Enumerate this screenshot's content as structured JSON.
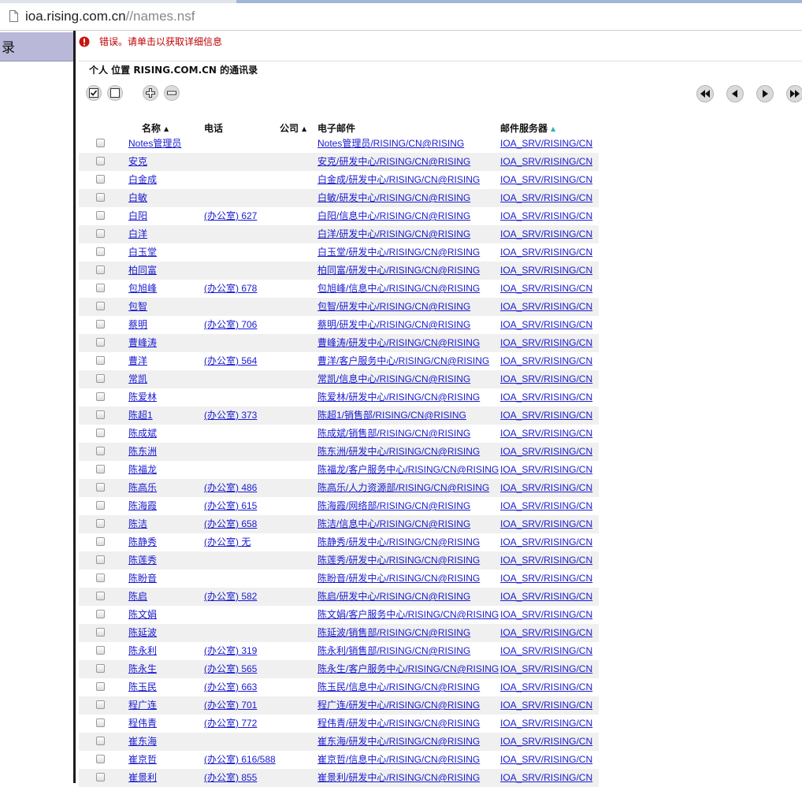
{
  "browser": {
    "url_host": "ioa.rising.com.cn",
    "url_path": "//names.nsf"
  },
  "left_frame": {
    "header": "录"
  },
  "error": {
    "message": "错误。请单击以获取详细信息"
  },
  "view": {
    "title": "个人 位置 RISING.COM.CN 的通讯录"
  },
  "columns": {
    "name": "名称",
    "phone": "电话",
    "company": "公司",
    "email": "电子邮件",
    "server": "邮件服务器"
  },
  "sort_glyph": "▲",
  "rows": [
    {
      "name": "Notes管理员",
      "phone": "",
      "email": "Notes管理员/RISING/CN@RISING",
      "server": "IOA_SRV/RISING/CN"
    },
    {
      "name": "安克",
      "phone": "",
      "email": "安克/研发中心/RISING/CN@RISING",
      "server": "IOA_SRV/RISING/CN"
    },
    {
      "name": "白金成",
      "phone": "",
      "email": "白金成/研发中心/RISING/CN@RISING",
      "server": "IOA_SRV/RISING/CN"
    },
    {
      "name": "白敏",
      "phone": "",
      "email": "白敏/研发中心/RISING/CN@RISING",
      "server": "IOA_SRV/RISING/CN"
    },
    {
      "name": "白阳",
      "phone": "(办公室) 627",
      "email": "白阳/信息中心/RISING/CN@RISING",
      "server": "IOA_SRV/RISING/CN"
    },
    {
      "name": "白洋",
      "phone": "",
      "email": "白洋/研发中心/RISING/CN@RISING",
      "server": "IOA_SRV/RISING/CN"
    },
    {
      "name": "白玉堂",
      "phone": "",
      "email": "白玉堂/研发中心/RISING/CN@RISING",
      "server": "IOA_SRV/RISING/CN"
    },
    {
      "name": "柏同富",
      "phone": "",
      "email": "柏同富/研发中心/RISING/CN@RISING",
      "server": "IOA_SRV/RISING/CN"
    },
    {
      "name": "包旭峰",
      "phone": "(办公室) 678",
      "email": "包旭峰/信息中心/RISING/CN@RISING",
      "server": "IOA_SRV/RISING/CN"
    },
    {
      "name": "包智",
      "phone": "",
      "email": "包智/研发中心/RISING/CN@RISING",
      "server": "IOA_SRV/RISING/CN"
    },
    {
      "name": "蔡明",
      "phone": "(办公室) 706",
      "email": "蔡明/研发中心/RISING/CN@RISING",
      "server": "IOA_SRV/RISING/CN"
    },
    {
      "name": "曹峰涛",
      "phone": "",
      "email": "曹峰涛/研发中心/RISING/CN@RISING",
      "server": "IOA_SRV/RISING/CN"
    },
    {
      "name": "曹洋",
      "phone": "(办公室) 564",
      "email": "曹洋/客户服务中心/RISING/CN@RISING",
      "server": "IOA_SRV/RISING/CN"
    },
    {
      "name": "常凯",
      "phone": "",
      "email": "常凯/信息中心/RISING/CN@RISING",
      "server": "IOA_SRV/RISING/CN"
    },
    {
      "name": "陈爱林",
      "phone": "",
      "email": "陈爱林/研发中心/RISING/CN@RISING",
      "server": "IOA_SRV/RISING/CN"
    },
    {
      "name": "陈超1",
      "phone": "(办公室) 373",
      "email": "陈超1/销售部/RISING/CN@RISING",
      "server": "IOA_SRV/RISING/CN"
    },
    {
      "name": "陈成斌",
      "phone": "",
      "email": "陈成斌/销售部/RISING/CN@RISING",
      "server": "IOA_SRV/RISING/CN"
    },
    {
      "name": "陈东洲",
      "phone": "",
      "email": "陈东洲/研发中心/RISING/CN@RISING",
      "server": "IOA_SRV/RISING/CN"
    },
    {
      "name": "陈福龙",
      "phone": "",
      "email": "陈福龙/客户服务中心/RISING/CN@RISING",
      "server": "IOA_SRV/RISING/CN"
    },
    {
      "name": "陈高乐",
      "phone": "(办公室) 486",
      "email": "陈高乐/人力资源部/RISING/CN@RISING",
      "server": "IOA_SRV/RISING/CN"
    },
    {
      "name": "陈海霞",
      "phone": "(办公室) 615",
      "email": "陈海霞/网络部/RISING/CN@RISING",
      "server": "IOA_SRV/RISING/CN"
    },
    {
      "name": "陈洁",
      "phone": "(办公室) 658",
      "email": "陈洁/信息中心/RISING/CN@RISING",
      "server": "IOA_SRV/RISING/CN"
    },
    {
      "name": "陈静秀",
      "phone": "(办公室) 无",
      "email": "陈静秀/研发中心/RISING/CN@RISING",
      "server": "IOA_SRV/RISING/CN"
    },
    {
      "name": "陈莲秀",
      "phone": "",
      "email": "陈莲秀/研发中心/RISING/CN@RISING",
      "server": "IOA_SRV/RISING/CN"
    },
    {
      "name": "陈盼音",
      "phone": "",
      "email": "陈盼音/研发中心/RISING/CN@RISING",
      "server": "IOA_SRV/RISING/CN"
    },
    {
      "name": "陈启",
      "phone": "(办公室) 582",
      "email": "陈启/研发中心/RISING/CN@RISING",
      "server": "IOA_SRV/RISING/CN"
    },
    {
      "name": "陈文娟",
      "phone": "",
      "email": "陈文娟/客户服务中心/RISING/CN@RISING",
      "server": "IOA_SRV/RISING/CN"
    },
    {
      "name": "陈延波",
      "phone": "",
      "email": "陈延波/销售部/RISING/CN@RISING",
      "server": "IOA_SRV/RISING/CN"
    },
    {
      "name": "陈永利",
      "phone": "(办公室) 319",
      "email": "陈永利/销售部/RISING/CN@RISING",
      "server": "IOA_SRV/RISING/CN"
    },
    {
      "name": "陈永生",
      "phone": "(办公室) 565",
      "email": "陈永生/客户服务中心/RISING/CN@RISING",
      "server": "IOA_SRV/RISING/CN"
    },
    {
      "name": "陈玉民",
      "phone": "(办公室) 663",
      "email": "陈玉民/信息中心/RISING/CN@RISING",
      "server": "IOA_SRV/RISING/CN"
    },
    {
      "name": "程广连",
      "phone": "(办公室) 701",
      "email": "程广连/研发中心/RISING/CN@RISING",
      "server": "IOA_SRV/RISING/CN"
    },
    {
      "name": "程伟青",
      "phone": "(办公室) 772",
      "email": "程伟青/研发中心/RISING/CN@RISING",
      "server": "IOA_SRV/RISING/CN"
    },
    {
      "name": "崔东海",
      "phone": "",
      "email": "崔东海/研发中心/RISING/CN@RISING",
      "server": "IOA_SRV/RISING/CN"
    },
    {
      "name": "崔京哲",
      "phone": "(办公室) 616/588",
      "email": "崔京哲/信息中心/RISING/CN@RISING",
      "server": "IOA_SRV/RISING/CN"
    },
    {
      "name": "崔景利",
      "phone": "(办公室) 855",
      "email": "崔景利/研发中心/RISING/CN@RISING",
      "server": "IOA_SRV/RISING/CN"
    }
  ],
  "colors": {
    "link": "#1a1ad0",
    "error": "#c00000",
    "alt_row": "#f0f0f0",
    "dir_header": "#b9b8d9"
  },
  "icons": {
    "select_all": "check-all-icon",
    "deselect_all": "uncheck-all-icon",
    "expand": "expand-icon",
    "collapse": "collapse-icon",
    "first": "first-page-icon",
    "prev": "prev-page-icon",
    "next": "next-page-icon",
    "last": "last-page-icon"
  }
}
